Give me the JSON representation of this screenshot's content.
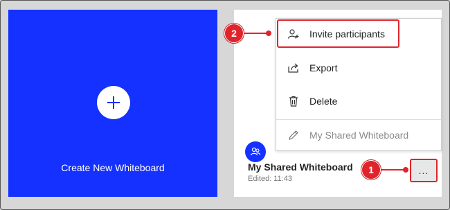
{
  "create_card": {
    "label": "Create New Whiteboard",
    "icon": "plus-icon",
    "color": "#1431ff"
  },
  "board": {
    "title": "My Shared Whiteboard",
    "edited": "Edited: 11:43",
    "avatar_icon": "participants-icon",
    "more_label": "..."
  },
  "menu": {
    "invite": "Invite participants",
    "export": "Export",
    "delete": "Delete",
    "shared": "My Shared Whiteboard"
  },
  "callouts": {
    "one": "1",
    "two": "2",
    "color": "#e0242b"
  }
}
